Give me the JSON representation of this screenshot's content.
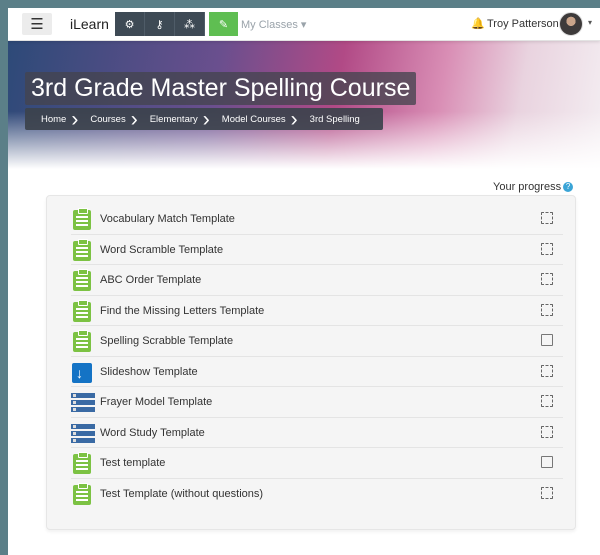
{
  "navbar": {
    "menu_icon": "hamburger-icon",
    "brand": "iLearn",
    "tool_icons": [
      "settings-icon",
      "key-icon",
      "sitemap-icon"
    ],
    "edit_icon": "edit-icon",
    "my_classes": "My Classes",
    "user_name": "Troy Patterson",
    "notification_icon": "bell-icon",
    "colors": {
      "toolbar": "#3e4a55",
      "edit": "#5fbe52"
    }
  },
  "header": {
    "title": "3rd Grade Master Spelling Course",
    "breadcrumbs": [
      "Home",
      "Courses",
      "Elementary",
      "Model Courses",
      "3rd Spelling"
    ]
  },
  "progress": {
    "label": "Your progress",
    "help_glyph": "?"
  },
  "activities": [
    {
      "label": "Vocabulary Match Template",
      "icon": "clipboard-icon",
      "completion": "manual"
    },
    {
      "label": "Word Scramble Template",
      "icon": "clipboard-icon",
      "completion": "manual"
    },
    {
      "label": "ABC Order Template",
      "icon": "clipboard-icon",
      "completion": "manual"
    },
    {
      "label": "Find the Missing Letters Template",
      "icon": "clipboard-icon",
      "completion": "manual"
    },
    {
      "label": "Spelling Scrabble Template",
      "icon": "clipboard-icon",
      "completion": "auto"
    },
    {
      "label": "Slideshow Template",
      "icon": "download-icon",
      "completion": "manual"
    },
    {
      "label": "Frayer Model Template",
      "icon": "database-icon",
      "completion": "manual"
    },
    {
      "label": "Word Study Template",
      "icon": "database-icon",
      "completion": "manual"
    },
    {
      "label": "Test template",
      "icon": "clipboard-icon",
      "completion": "auto"
    },
    {
      "label": "Test Template (without questions)",
      "icon": "clipboard-icon",
      "completion": "manual"
    }
  ]
}
